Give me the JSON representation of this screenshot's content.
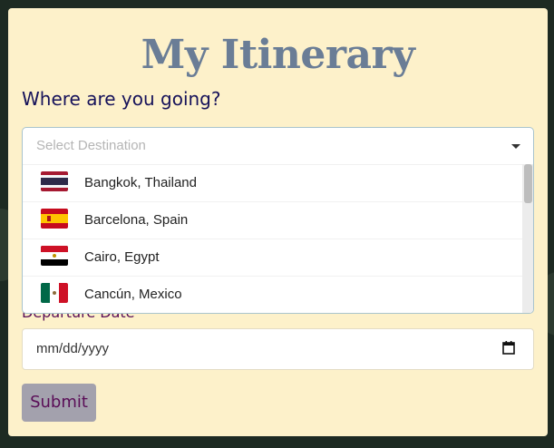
{
  "title": "My Itinerary",
  "question": "Where are you going?",
  "destination_select": {
    "placeholder": "Select Destination",
    "options": [
      {
        "flag": "thailand-flag-icon",
        "label": "Bangkok, Thailand"
      },
      {
        "flag": "spain-flag-icon",
        "label": "Barcelona, Spain"
      },
      {
        "flag": "egypt-flag-icon",
        "label": "Cairo, Egypt"
      },
      {
        "flag": "mexico-flag-icon",
        "label": "Cancún, Mexico"
      }
    ]
  },
  "departure": {
    "label": "Departure Date",
    "value": "mm/dd/yyyy"
  },
  "submit_label": "Submit",
  "colors": {
    "card": "#fdf1ca",
    "title": "#6a7d96",
    "question": "#16125a",
    "label": "#5a0d57",
    "button": "#a3a1ad"
  }
}
